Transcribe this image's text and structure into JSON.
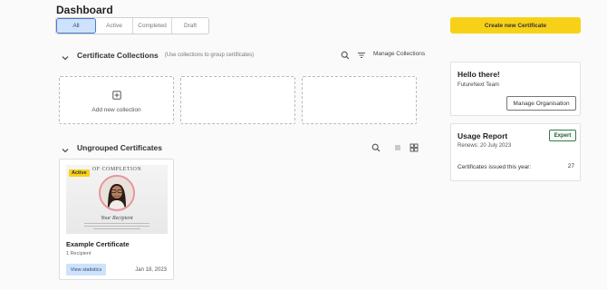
{
  "page": {
    "title": "Dashboard"
  },
  "tabs": [
    {
      "label": "All",
      "active": true
    },
    {
      "label": "Active",
      "active": false
    },
    {
      "label": "Completed",
      "active": false
    },
    {
      "label": "Draft",
      "active": false
    }
  ],
  "create_button": {
    "label": "Create new Certificate"
  },
  "collections": {
    "title": "Certificate Collections",
    "subtitle": "(Use collections to group certificates)",
    "manage_label": "Manage Collections",
    "add_label": "Add new collection"
  },
  "ungrouped": {
    "title": "Ungrouped Certificates",
    "certificates": [
      {
        "status": "Active",
        "thumb_heading": "OF COMPLETION",
        "thumb_name": "Your Recipient",
        "title": "Example Certificate",
        "recipients": "1 Recipient",
        "stats_label": "View statistics",
        "date": "Jan 18, 2023"
      }
    ]
  },
  "hello_panel": {
    "title": "Hello there!",
    "org_name": "FutureNext Team",
    "manage_label": "Manage Organisation"
  },
  "usage_panel": {
    "title": "Usage Report",
    "plan": "Expert",
    "renews": "Renews: 20 July 2023",
    "issued_label": "Certificates issued this year:",
    "issued_count": "27"
  },
  "colors": {
    "accent_yellow": "#f7d117",
    "tab_active_bg": "#cfe2fb",
    "tab_active_border": "#4a7cc9",
    "plan_badge_border": "#3a7a4a"
  },
  "icons": [
    "chevron-down-icon",
    "search-icon",
    "filter-icon",
    "plus-square-icon",
    "list-view-icon",
    "grid-view-icon"
  ]
}
